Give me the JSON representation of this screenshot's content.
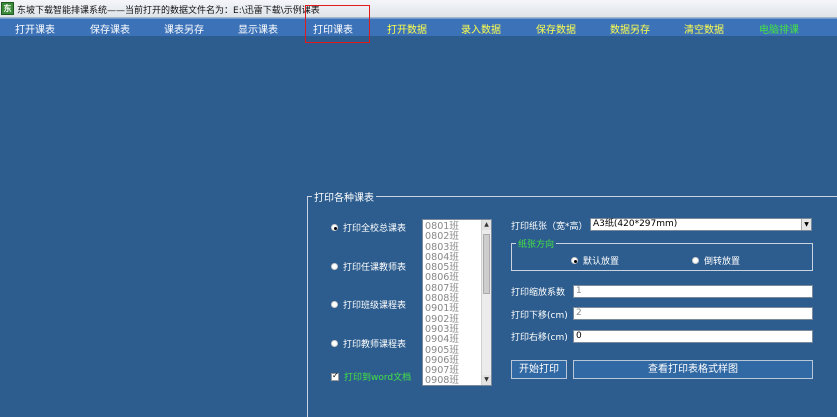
{
  "window": {
    "app_icon": "hand-icon",
    "title": "东坡下载智能排课系统——当前打开的数据文件名为：E:\\迅雷下载\\示例课表"
  },
  "menu": {
    "items": [
      {
        "label": "打开课表",
        "color": "#ffffff"
      },
      {
        "label": "保存课表",
        "color": "#ffffff"
      },
      {
        "label": "课表另存",
        "color": "#ffffff"
      },
      {
        "label": "显示课表",
        "color": "#ffffff"
      },
      {
        "label": "打印课表",
        "color": "#ffffff"
      },
      {
        "label": "打开数据",
        "color": "#ffff4d"
      },
      {
        "label": "录入数据",
        "color": "#ffff4d"
      },
      {
        "label": "保存数据",
        "color": "#ffff4d"
      },
      {
        "label": "数据另存",
        "color": "#ffff4d"
      },
      {
        "label": "清空数据",
        "color": "#ffff4d"
      },
      {
        "label": "电脑排课",
        "color": "#44e244"
      }
    ],
    "highlighted": "打印课表",
    "highlight_color": "#e21a1a"
  },
  "print_panel": {
    "title": "打印各种课表",
    "options": [
      {
        "label": "打印全校总课表",
        "selected": true
      },
      {
        "label": "打印任课教师表",
        "selected": false
      },
      {
        "label": "打印班级课程表",
        "selected": false
      },
      {
        "label": "打印教师课程表",
        "selected": false
      }
    ],
    "to_word": {
      "label": "打印到word文档",
      "checked": true
    },
    "class_list": [
      "0801班",
      "0802班",
      "0803班",
      "0804班",
      "0805班",
      "0806班",
      "0807班",
      "0808班",
      "0901班",
      "0902班",
      "0903班",
      "0904班",
      "0905班",
      "0906班",
      "0907班",
      "0908班"
    ],
    "paper": {
      "label": "打印纸张（宽*高）",
      "value": "A3纸(420*297mm)"
    },
    "orientation": {
      "title": "纸张方向",
      "options": [
        {
          "label": "默认放置",
          "selected": true
        },
        {
          "label": "倒转放置",
          "selected": false
        }
      ]
    },
    "scale": {
      "label": "打印缩放系数",
      "value": "1"
    },
    "offset_down": {
      "label": "打印下移(cm)",
      "value": "2"
    },
    "offset_right": {
      "label": "打印右移(cm)",
      "value": "0"
    },
    "start_button": "开始打印",
    "preview_button": "查看打印表格式样图"
  },
  "colors": {
    "background": "#2d5d8e",
    "menubar": "#3c72b8",
    "accent_green": "#44e244",
    "accent_yellow": "#ffff4d"
  }
}
